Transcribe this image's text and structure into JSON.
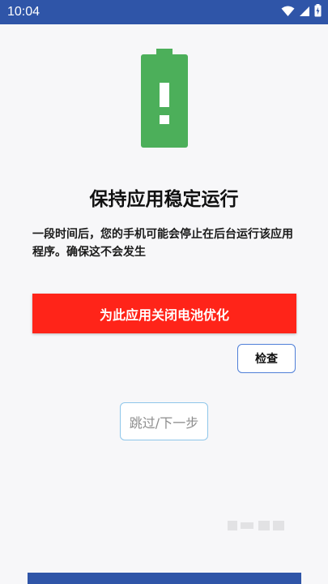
{
  "status_bar": {
    "time": "10:04",
    "icons": [
      "wifi-icon",
      "signal-icon",
      "battery-charging-icon"
    ],
    "background": "#2f55a8"
  },
  "illustration": {
    "icon": "battery-alert-icon",
    "color": "#4caf5a"
  },
  "title": "保持应用稳定运行",
  "description": "一段时间后，您的手机可能会停止在后台运行该应用程序。确保这不会发生",
  "buttons": {
    "disable_optimization": "为此应用关闭电池优化",
    "check": "检查",
    "skip": "跳过/下一步"
  },
  "colors": {
    "primary": "#ff2419",
    "accent": "#4f7fd8",
    "skip_border": "#8fc6ea"
  }
}
